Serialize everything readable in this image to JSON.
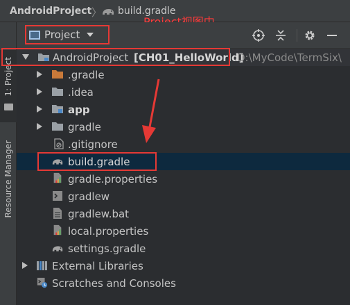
{
  "breadcrumb": {
    "project": "AndroidProject",
    "file": "build.gradle"
  },
  "annotation": {
    "label": "Project视图中"
  },
  "tool_strip": {
    "project_tab": "1: Project",
    "resource_tab": "Resource Manager"
  },
  "header": {
    "view_selector": "Project"
  },
  "tree": {
    "root": {
      "name": "AndroidProject",
      "module": "[CH01_HelloWorld]",
      "path": "D:\\MyCode\\TermSix\\"
    },
    "items": [
      {
        "label": ".gradle"
      },
      {
        "label": ".idea"
      },
      {
        "label": "app"
      },
      {
        "label": "gradle"
      },
      {
        "label": ".gitignore"
      },
      {
        "label": "build.gradle"
      },
      {
        "label": "gradle.properties"
      },
      {
        "label": "gradlew"
      },
      {
        "label": "gradlew.bat"
      },
      {
        "label": "local.properties"
      },
      {
        "label": "settings.gradle"
      }
    ],
    "external_libraries": "External Libraries",
    "scratches": "Scratches and Consoles"
  },
  "colors": {
    "accent_red": "#e53935",
    "selection": "#0d293e",
    "orange_folder": "#c97a3a",
    "folder_gray": "#9aa0a6"
  }
}
